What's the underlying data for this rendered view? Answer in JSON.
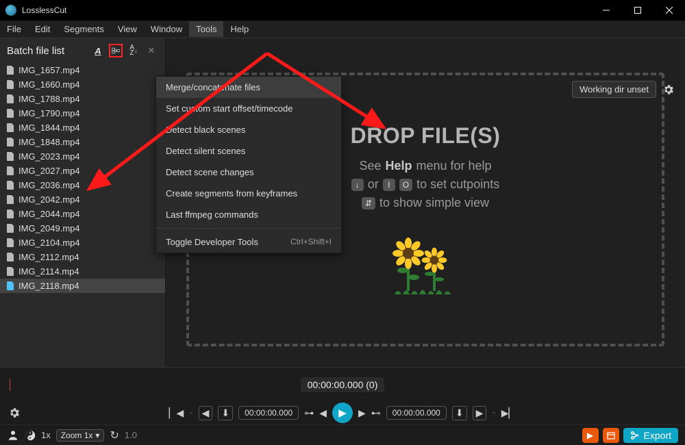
{
  "appTitle": "LosslessCut",
  "menubar": [
    "File",
    "Edit",
    "Segments",
    "View",
    "Window",
    "Tools",
    "Help"
  ],
  "activeMenuIndex": 5,
  "sidebar": {
    "title": "Batch file list",
    "files": [
      "IMG_1657.mp4",
      "IMG_1660.mp4",
      "IMG_1788.mp4",
      "IMG_1790.mp4",
      "IMG_1844.mp4",
      "IMG_1848.mp4",
      "IMG_2023.mp4",
      "IMG_2027.mp4",
      "IMG_2036.mp4",
      "IMG_2042.mp4",
      "IMG_2044.mp4",
      "IMG_2049.mp4",
      "IMG_2104.mp4",
      "IMG_2112.mp4",
      "IMG_2114.mp4",
      "IMG_2118.mp4"
    ],
    "selectedIndex": 15
  },
  "toolsMenu": {
    "items": [
      {
        "label": "Merge/concatenate files",
        "hovered": true
      },
      {
        "label": "Set custom start offset/timecode"
      },
      {
        "label": "Detect black scenes"
      },
      {
        "label": "Detect silent scenes"
      },
      {
        "label": "Detect scene changes"
      },
      {
        "label": "Create segments from keyframes"
      },
      {
        "label": "Last ffmpeg commands"
      },
      {
        "sep": true
      },
      {
        "label": "Toggle Developer Tools",
        "shortcut": "Ctrl+Shift+I"
      }
    ]
  },
  "dropArea": {
    "title": "DROP FILE(S)",
    "line1_pre": "See",
    "line1_strong": "Help",
    "line1_post": "menu for help",
    "line2_part1": "or",
    "line2_part2": "to set cutpoints",
    "line3": "to show simple view"
  },
  "topRight": {
    "workingDir": "Working dir unset"
  },
  "timeline": {
    "timecode": "00:00:00.000 (0)"
  },
  "controls": {
    "timecodeStart": "00:00:00.000",
    "timecodeEnd": "00:00:00.000"
  },
  "bottombar": {
    "speed": "1x",
    "zoom": "Zoom 1x",
    "ratio": "1.0",
    "exportLabel": "Export"
  }
}
